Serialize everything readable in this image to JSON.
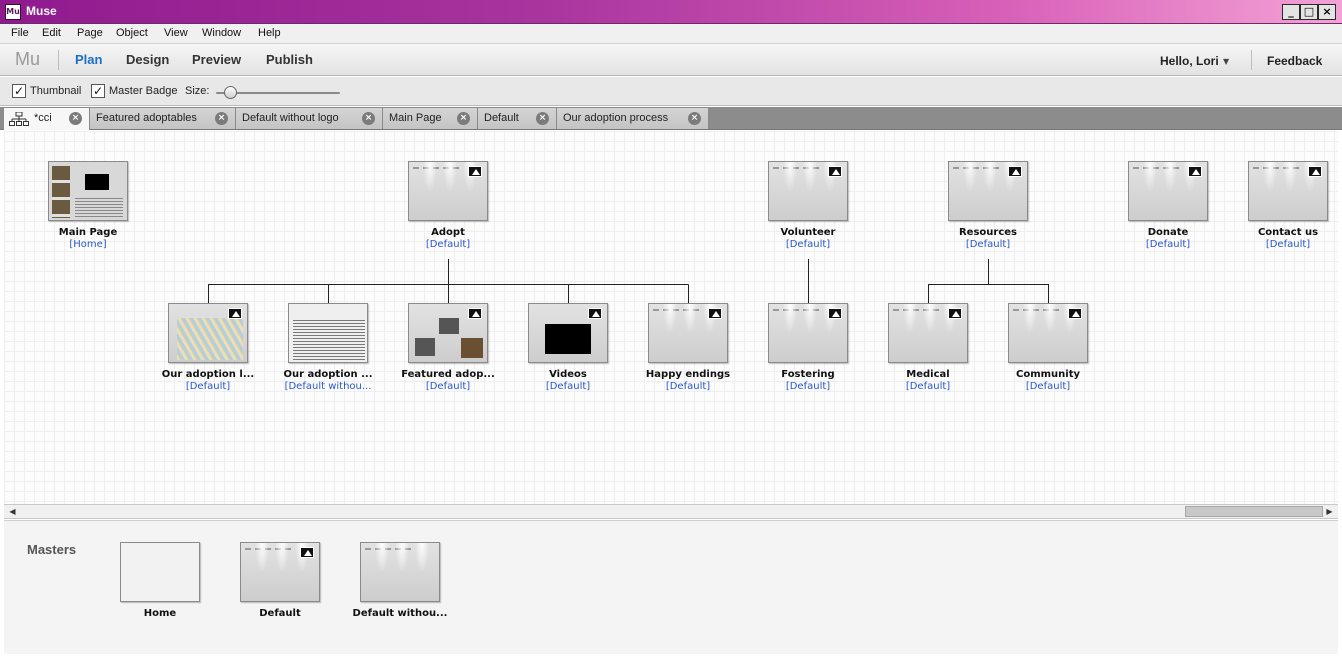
{
  "window": {
    "title": "Muse",
    "app_icon": "Mu",
    "minimize_icon": "_",
    "maximize_icon": "□",
    "close_icon": "×"
  },
  "menu": [
    "File",
    "Edit",
    "Page",
    "Object",
    "View",
    "Window",
    "Help"
  ],
  "appbar": {
    "logo": "Mu",
    "modes": [
      "Plan",
      "Design",
      "Preview",
      "Publish"
    ],
    "active_mode": "Plan",
    "greeting": "Hello, Lori",
    "caret": "▼",
    "feedback": "Feedback"
  },
  "options": {
    "thumbnail_label": "Thumbnail",
    "thumbnail_checked": "✓",
    "master_badge_label": "Master Badge",
    "master_badge_checked": "✓",
    "size_label": "Size:",
    "size_value": 0.12
  },
  "tabs": [
    {
      "label": "*cci",
      "icon": "sitemap-icon"
    },
    {
      "label": "Featured adoptables"
    },
    {
      "label": "Default without logo"
    },
    {
      "label": "Main Page"
    },
    {
      "label": "Default"
    },
    {
      "label": "Our adoption process"
    }
  ],
  "tab_close_glyph": "×",
  "sitemap": {
    "top_pages": [
      {
        "name": "Main Page",
        "master": "[Home]"
      },
      {
        "name": "Adopt",
        "master": "[Default]"
      },
      {
        "name": "Volunteer",
        "master": "[Default]"
      },
      {
        "name": "Resources",
        "master": "[Default]"
      },
      {
        "name": "Donate",
        "master": "[Default]"
      },
      {
        "name": "Contact us",
        "master": "[Default]"
      }
    ],
    "child_pages": [
      {
        "name": "Our adoption l...",
        "master": "[Default]"
      },
      {
        "name": "Our adoption ...",
        "master": "[Default withou..."
      },
      {
        "name": "Featured adop...",
        "master": "[Default]"
      },
      {
        "name": "Videos",
        "master": "[Default]"
      },
      {
        "name": "Happy endings",
        "master": "[Default]"
      },
      {
        "name": "Fostering",
        "master": "[Default]"
      },
      {
        "name": "Medical",
        "master": "[Default]"
      },
      {
        "name": "Community",
        "master": "[Default]"
      }
    ]
  },
  "scrollbar": {
    "left_arrow": "◀",
    "right_arrow": "▶"
  },
  "masters": {
    "title": "Masters",
    "items": [
      "Home",
      "Default",
      "Default withou..."
    ]
  },
  "colors": {
    "accent": "#1b6fc7",
    "link": "#2a58c8",
    "title_start": "#8e1a8e",
    "title_end": "#f3a2d6"
  }
}
